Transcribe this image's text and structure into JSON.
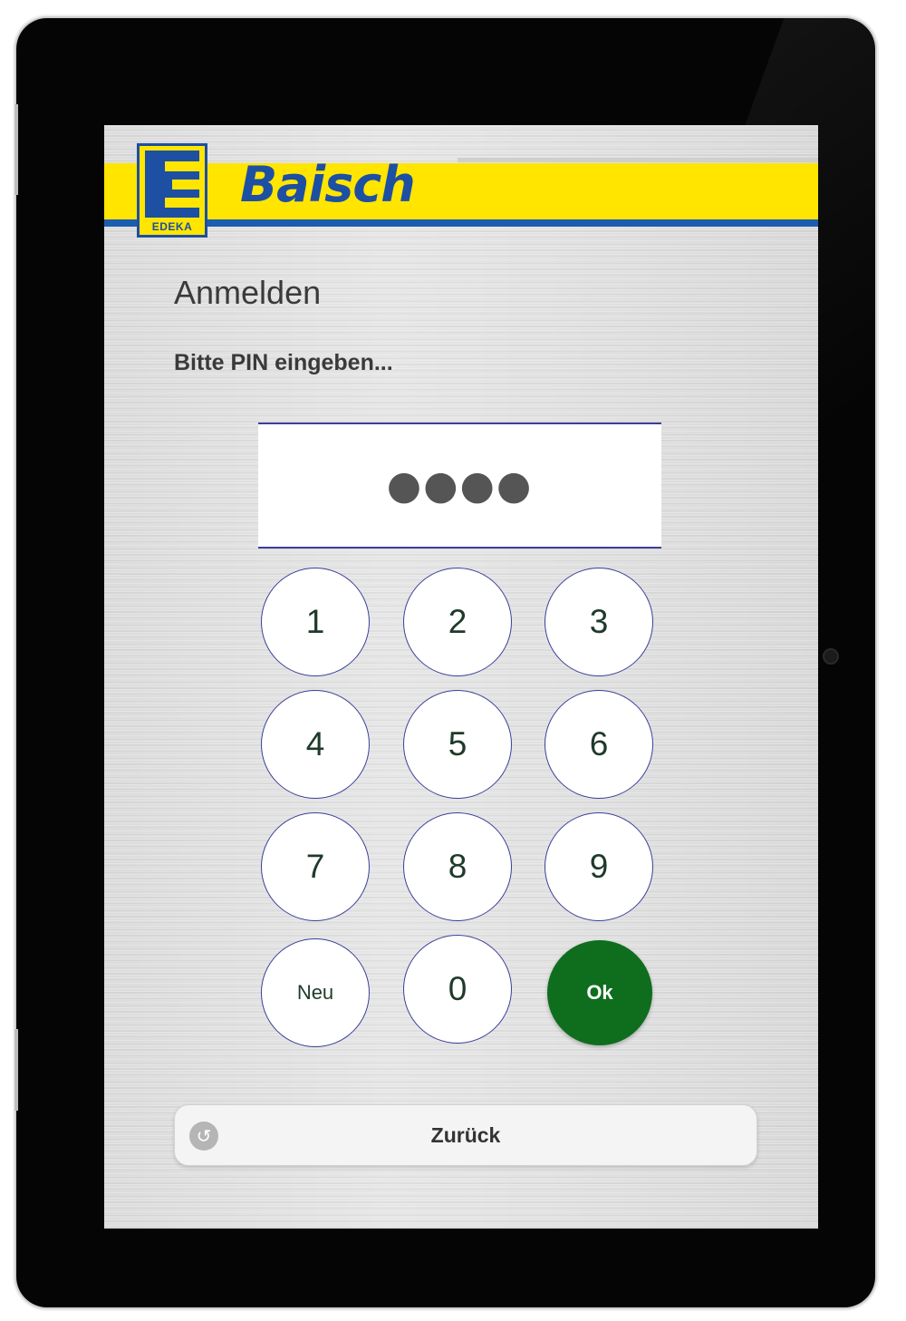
{
  "header": {
    "logo_letter": "E",
    "logo_text": "EDEKA",
    "brand": "Baisch",
    "brand_color": "#1d4fa3",
    "banner_color": "#ffe500"
  },
  "page": {
    "title": "Anmelden",
    "prompt": "Bitte PIN eingeben..."
  },
  "pin": {
    "masked_value": "●●●●",
    "entered_length": 4
  },
  "keypad": {
    "keys": [
      "1",
      "2",
      "3",
      "4",
      "5",
      "6",
      "7",
      "8",
      "9",
      "Neu",
      "0",
      "Ok"
    ],
    "ok_color": "#0e6e1e"
  },
  "footer": {
    "back_label": "Zurück",
    "back_icon": "undo-arrow-icon"
  }
}
